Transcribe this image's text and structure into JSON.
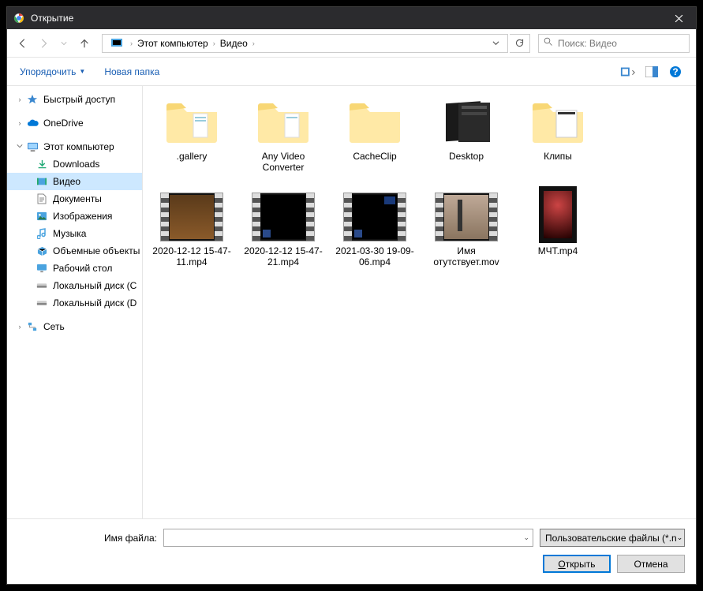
{
  "titlebar": {
    "title": "Открытие"
  },
  "breadcrumb": {
    "root": "Этот компьютер",
    "current": "Видео"
  },
  "search": {
    "placeholder": "Поиск: Видео"
  },
  "toolbar": {
    "organize": "Упорядочить",
    "newfolder": "Новая папка"
  },
  "sidebar": {
    "quick": "Быстрый доступ",
    "onedrive": "OneDrive",
    "thispc": "Этот компьютер",
    "children": {
      "downloads": "Downloads",
      "video": "Видео",
      "documents": "Документы",
      "pictures": "Изображения",
      "music": "Музыка",
      "objects3d": "Объемные объекты",
      "desktop": "Рабочий стол",
      "disk_c": "Локальный диск (C",
      "disk_d": "Локальный диск (D"
    },
    "network": "Сеть"
  },
  "items": {
    "gallery": ".gallery",
    "anyvideo": "Any Video Converter",
    "cacheclip": "CacheClip",
    "desktop": "Desktop",
    "clips": "Клипы",
    "v1": "2020-12-12 15-47-11.mp4",
    "v2": "2020-12-12 15-47-21.mp4",
    "v3": "2021-03-30 19-09-06.mp4",
    "v4": "Имя отутствует.mov",
    "v5": "МЧТ.mp4"
  },
  "footer": {
    "filename_label": "Имя файла:",
    "filter": "Пользовательские файлы (*.n",
    "open": "Открыть",
    "cancel": "Отмена"
  }
}
